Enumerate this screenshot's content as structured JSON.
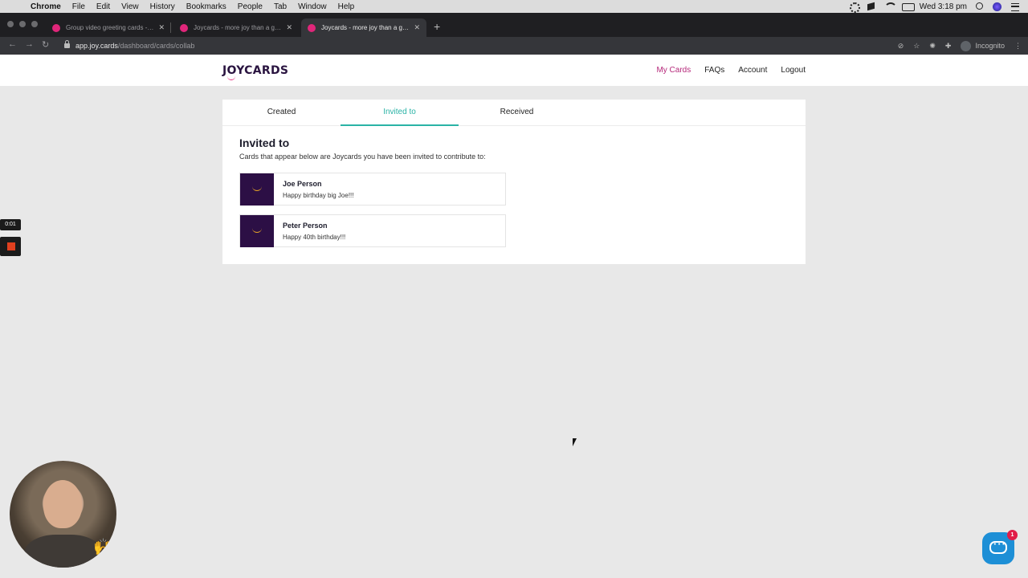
{
  "menubar": {
    "apple": "",
    "items": [
      "Chrome",
      "File",
      "Edit",
      "View",
      "History",
      "Bookmarks",
      "People",
      "Tab",
      "Window",
      "Help"
    ],
    "clock": "Wed 3:18 pm"
  },
  "browser": {
    "tabs": [
      {
        "title": "Group video greeting cards - Joycards"
      },
      {
        "title": "Joycards - more joy than a greeting card"
      },
      {
        "title": "Joycards - more joy than a greeting card"
      }
    ],
    "new_tab": "+",
    "url_host": "app.joy.cards",
    "url_path": "/dashboard/cards/collab",
    "profile_label": "Incognito"
  },
  "site": {
    "logo": "JOYCARDS",
    "nav": [
      {
        "label": "My Cards",
        "active": true
      },
      {
        "label": "FAQs"
      },
      {
        "label": "Account"
      },
      {
        "label": "Logout"
      }
    ]
  },
  "dashboard": {
    "tabs": [
      {
        "label": "Created"
      },
      {
        "label": "Invited to",
        "active": true
      },
      {
        "label": "Received"
      }
    ],
    "title": "Invited to",
    "description": "Cards that appear below are Joycards you have been invited to contribute to:",
    "cards": [
      {
        "name": "Joe Person",
        "message": "Happy birthday big Joe!!!"
      },
      {
        "name": "Peter Person",
        "message": "Happy 40th birthday!!!"
      }
    ]
  },
  "recording": {
    "timer": "0:01"
  },
  "chat": {
    "badge": "1"
  },
  "colors": {
    "brand": "#2c0f45",
    "accent_pink": "#b5287a",
    "tab_active": "#2ab3a6",
    "chat_blue": "#1d8fd6"
  }
}
